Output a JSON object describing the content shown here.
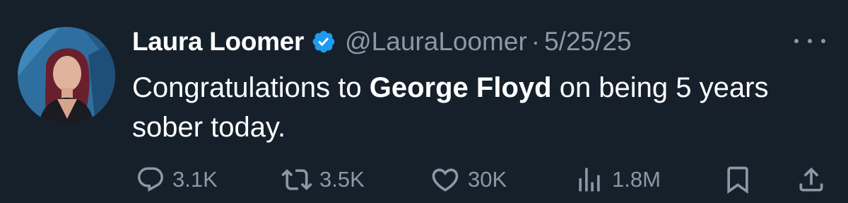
{
  "tweet": {
    "author_name": "Laura Loomer",
    "handle": "@LauraLoomer",
    "separator": "·",
    "date": "5/25/25",
    "text_before": "Congratulations to ",
    "text_bold": "George Floyd",
    "text_after": " on being 5 years sober today."
  },
  "actions": {
    "replies": "3.1K",
    "reposts": "3.5K",
    "likes": "30K",
    "views": "1.8M"
  },
  "colors": {
    "background": "#15202b",
    "secondary_text": "#8b98a5",
    "verified_badge": "#1d9bf0"
  },
  "icons": [
    "reply-icon",
    "repost-icon",
    "like-icon",
    "views-icon",
    "bookmark-icon",
    "share-icon",
    "more-icon",
    "verified-icon"
  ]
}
